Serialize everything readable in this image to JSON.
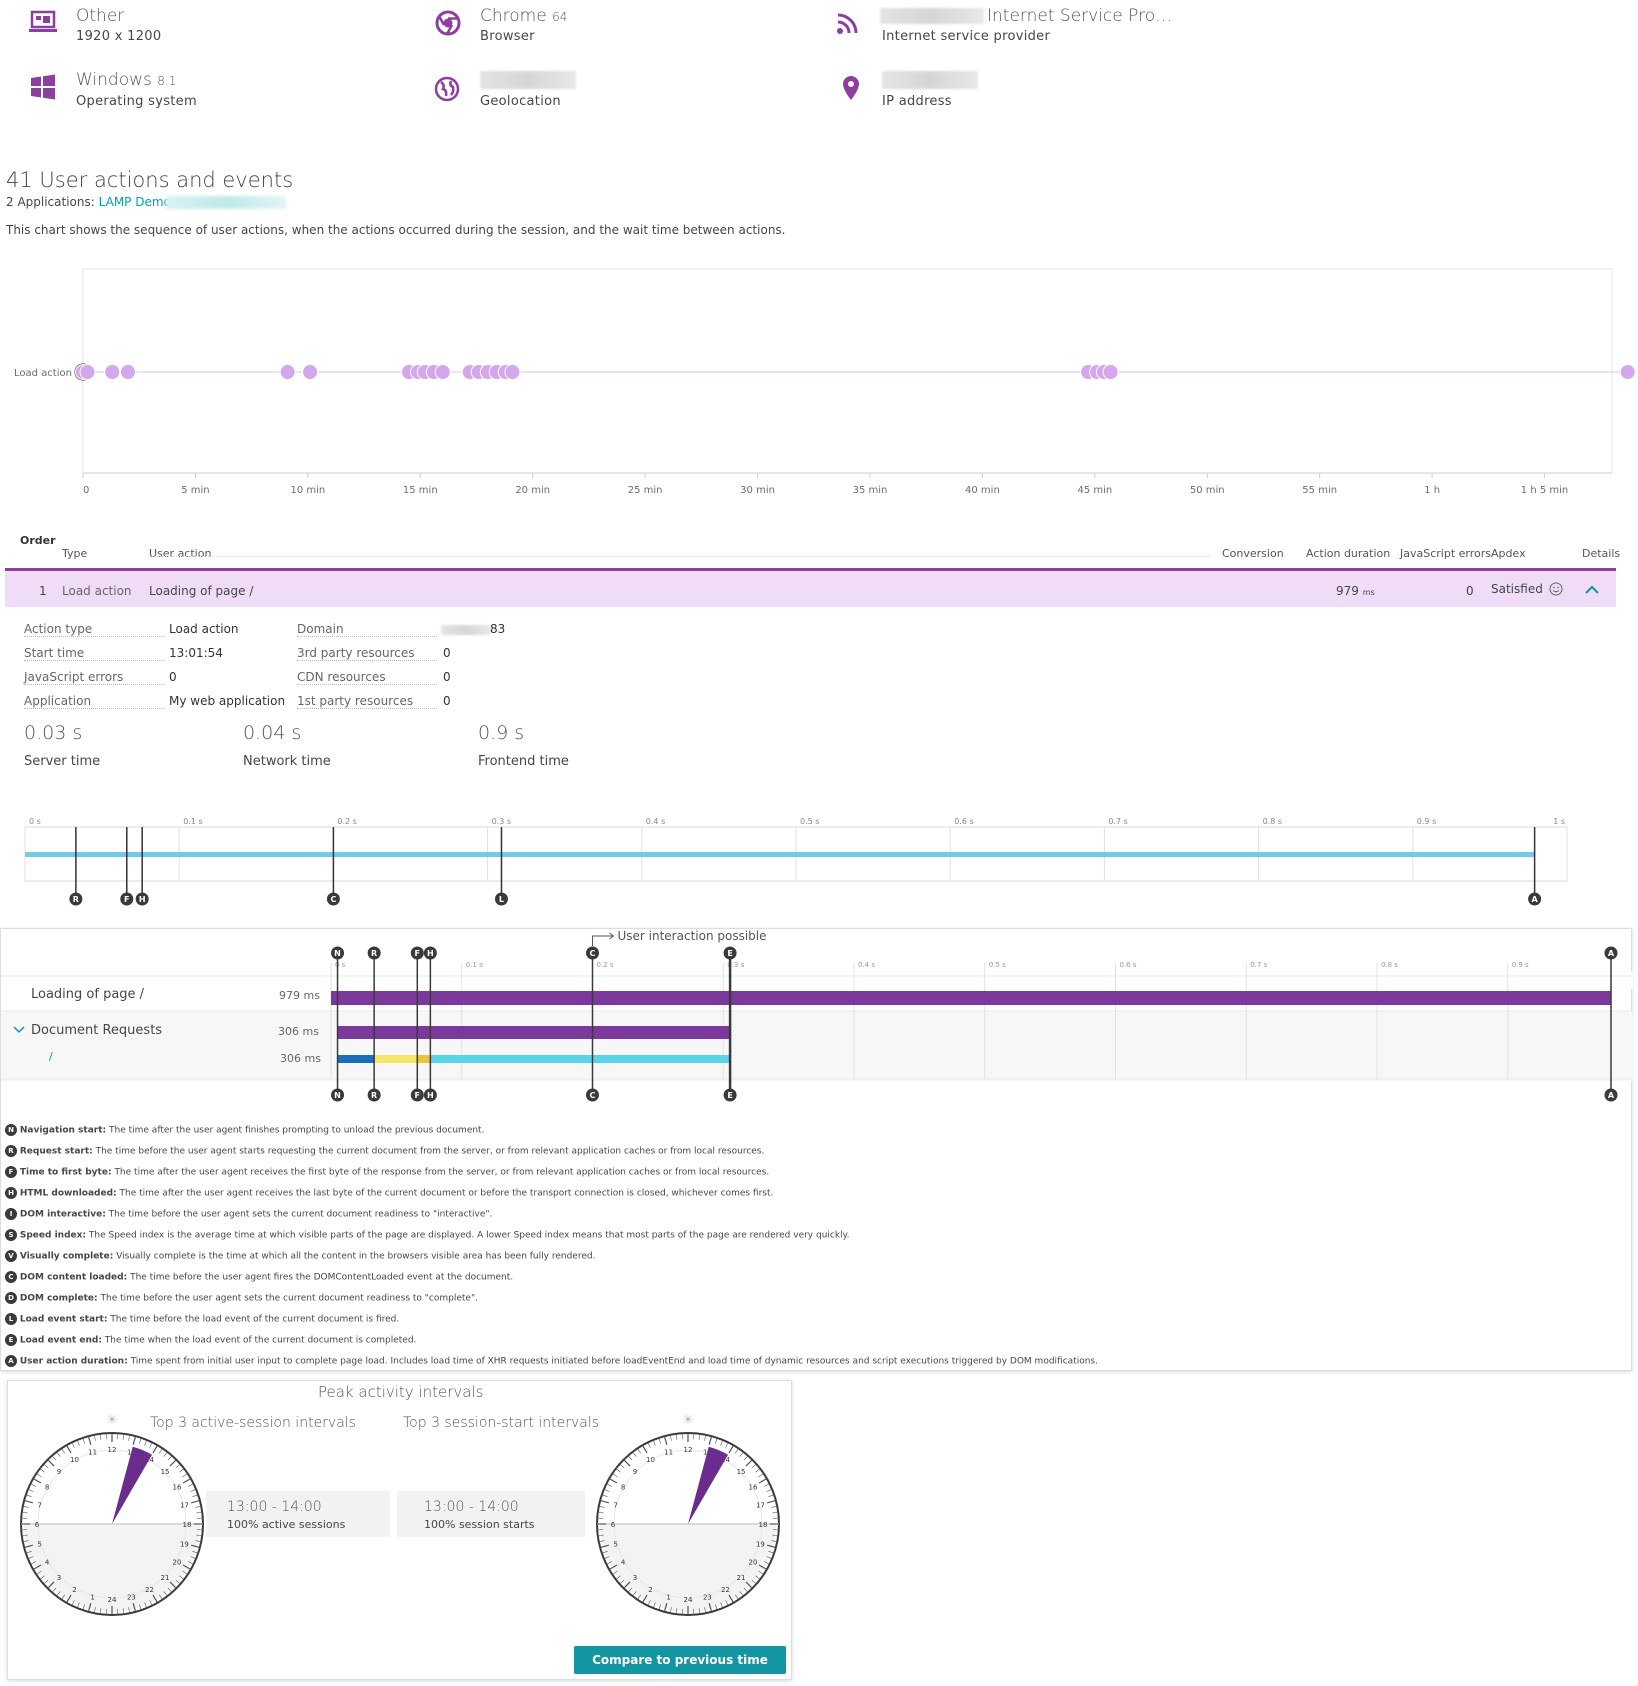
{
  "info": {
    "device": {
      "name": "Other",
      "detail": "1920 x 1200",
      "icon": "monitor-icon"
    },
    "browser": {
      "name": "Chrome",
      "version": "64",
      "detail": "Browser",
      "icon": "chrome-icon"
    },
    "isp": {
      "name": "Internet Service Pro…",
      "detail": "Internet service provider",
      "icon": "rss-icon"
    },
    "os": {
      "name": "Windows",
      "version": "8.1",
      "detail": "Operating system",
      "icon": "windows-icon"
    },
    "geo": {
      "detail": "Geolocation",
      "icon": "globe-icon"
    },
    "ip": {
      "detail": "IP address",
      "icon": "location-pin-icon"
    }
  },
  "actions": {
    "title": "41 User actions and events",
    "apps_prefix": "2 Applications:",
    "app_link": "LAMP Demo",
    "app_sep": ",",
    "description": "This chart shows the sequence of user actions, when the actions occurred during the session, and the wait time between actions."
  },
  "chart_data": {
    "type": "scatter",
    "series": [
      {
        "name": "Load action",
        "x_min": [
          0,
          0.2,
          1.3,
          2.0,
          9.1,
          10.1,
          14.5,
          14.9,
          15.2,
          15.6,
          16.0,
          17.2,
          17.6,
          18.0,
          18.4,
          18.8,
          19.1,
          44.7,
          45.1,
          45.4,
          45.7,
          68.7
        ]
      }
    ],
    "ylabel_row": "Load action",
    "x_ticks": [
      "0",
      "5 min",
      "10 min",
      "15 min",
      "20 min",
      "25 min",
      "30 min",
      "35 min",
      "40 min",
      "45 min",
      "50 min",
      "55 min",
      "1 h",
      "1 h 5 min"
    ],
    "xlim_min": [
      0,
      68
    ]
  },
  "table": {
    "headers": {
      "order": "Order",
      "type": "Type",
      "user_action": "User action",
      "conversion": "Conversion",
      "action_duration": "Action duration",
      "js_errors": "JavaScript errors",
      "apdex": "Apdex",
      "details": "Details"
    },
    "row": {
      "order": "1",
      "type": "Load action",
      "action": "Loading of page /",
      "duration": "979",
      "duration_unit": "ms",
      "js_errors": "0",
      "apdex": "Satisfied"
    }
  },
  "details": {
    "left": [
      {
        "k": "Action type",
        "v": "Load action"
      },
      {
        "k": "Start time",
        "v": "13:01:54"
      },
      {
        "k": "JavaScript errors",
        "v": "0"
      },
      {
        "k": "Application",
        "v": "My web application"
      }
    ],
    "right": [
      {
        "k": "Domain",
        "v": "83"
      },
      {
        "k": "3rd party resources",
        "v": "0"
      },
      {
        "k": "CDN resources",
        "v": "0"
      },
      {
        "k": "1st party resources",
        "v": "0"
      }
    ],
    "metrics": [
      {
        "v": "0.03 s",
        "l": "Server time"
      },
      {
        "v": "0.04 s",
        "l": "Network time"
      },
      {
        "v": "0.9 s",
        "l": "Frontend time"
      }
    ]
  },
  "timeline": {
    "ticks": [
      "0 s",
      "0.1 s",
      "0.2 s",
      "0.3 s",
      "0.4 s",
      "0.5 s",
      "0.6 s",
      "0.7 s",
      "0.8 s",
      "0.9 s",
      "1 s"
    ],
    "markers": [
      {
        "l": "R",
        "t": 0.033
      },
      {
        "l": "F",
        "t": 0.066
      },
      {
        "l": "H",
        "t": 0.076
      },
      {
        "l": "C",
        "t": 0.2
      },
      {
        "l": "L",
        "t": 0.309
      },
      {
        "l": "A",
        "t": 0.979
      }
    ]
  },
  "waterfall": {
    "interaction_label": "User interaction possible",
    "ticks": [
      "0 s",
      "0.1 s",
      "0.2 s",
      "0.3 s",
      "0.4 s",
      "0.5 s",
      "0.6 s",
      "0.7 s",
      "0.8 s",
      "0.9 s"
    ],
    "rows": [
      {
        "name": "Loading of page /",
        "ms": "979 ms"
      },
      {
        "name": "Document Requests",
        "ms": "306 ms"
      },
      {
        "name": "/",
        "ms": "306 ms"
      }
    ],
    "markers_top": [
      "N",
      "R",
      "F",
      "H",
      "C",
      "E",
      "A"
    ]
  },
  "legend": [
    {
      "l": "N",
      "t": "Navigation start:",
      "d": "The time after the user agent finishes prompting to unload the previous document."
    },
    {
      "l": "R",
      "t": "Request start:",
      "d": "The time before the user agent starts requesting the current document from the server, or from relevant application caches or from local resources."
    },
    {
      "l": "F",
      "t": "Time to first byte:",
      "d": "The time after the user agent receives the first byte of the response from the server, or from relevant application caches or from local resources."
    },
    {
      "l": "H",
      "t": "HTML downloaded:",
      "d": "The time after the user agent receives the last byte of the current document or before the transport connection is closed, whichever comes first."
    },
    {
      "l": "I",
      "t": "DOM interactive:",
      "d": "The time before the user agent sets the current document readiness to \"interactive\"."
    },
    {
      "l": "S",
      "t": "Speed index:",
      "d": "The Speed index is the average time at which visible parts of the page are displayed. A lower Speed index means that most parts of the page are rendered very quickly."
    },
    {
      "l": "V",
      "t": "Visually complete:",
      "d": "Visually complete is the time at which all the content in the browsers visible area has been fully rendered."
    },
    {
      "l": "C",
      "t": "DOM content loaded:",
      "d": "The time before the user agent fires the DOMContentLoaded event at the document."
    },
    {
      "l": "D",
      "t": "DOM complete:",
      "d": "The time before the user agent sets the current document readiness to \"complete\"."
    },
    {
      "l": "L",
      "t": "Load event start:",
      "d": "The time before the load event of the current document is fired."
    },
    {
      "l": "E",
      "t": "Load event end:",
      "d": "The time when the load event of the current document is completed."
    },
    {
      "l": "A",
      "t": "User action duration:",
      "d": "Time spent from initial user input to complete page load. Includes load time of XHR requests initiated before loadEventEnd and load time of dynamic resources and script executions triggered by DOM modifications."
    }
  ],
  "peak": {
    "title": "Peak activity intervals",
    "active_title": "Top 3 active-session intervals",
    "start_title": "Top 3 session-start intervals",
    "active_interval": "13:00 - 14:00",
    "active_sub": "100% active sessions",
    "start_interval": "13:00 - 14:00",
    "start_sub": "100% session starts",
    "compare_button": "Compare to previous time frame",
    "clock_hours": [
      "12",
      "13",
      "14",
      "15",
      "16",
      "17",
      "18",
      "19",
      "20",
      "21",
      "22",
      "23",
      "24",
      "1",
      "2",
      "3",
      "4",
      "5",
      "6",
      "7",
      "8",
      "9",
      "10",
      "11"
    ]
  }
}
